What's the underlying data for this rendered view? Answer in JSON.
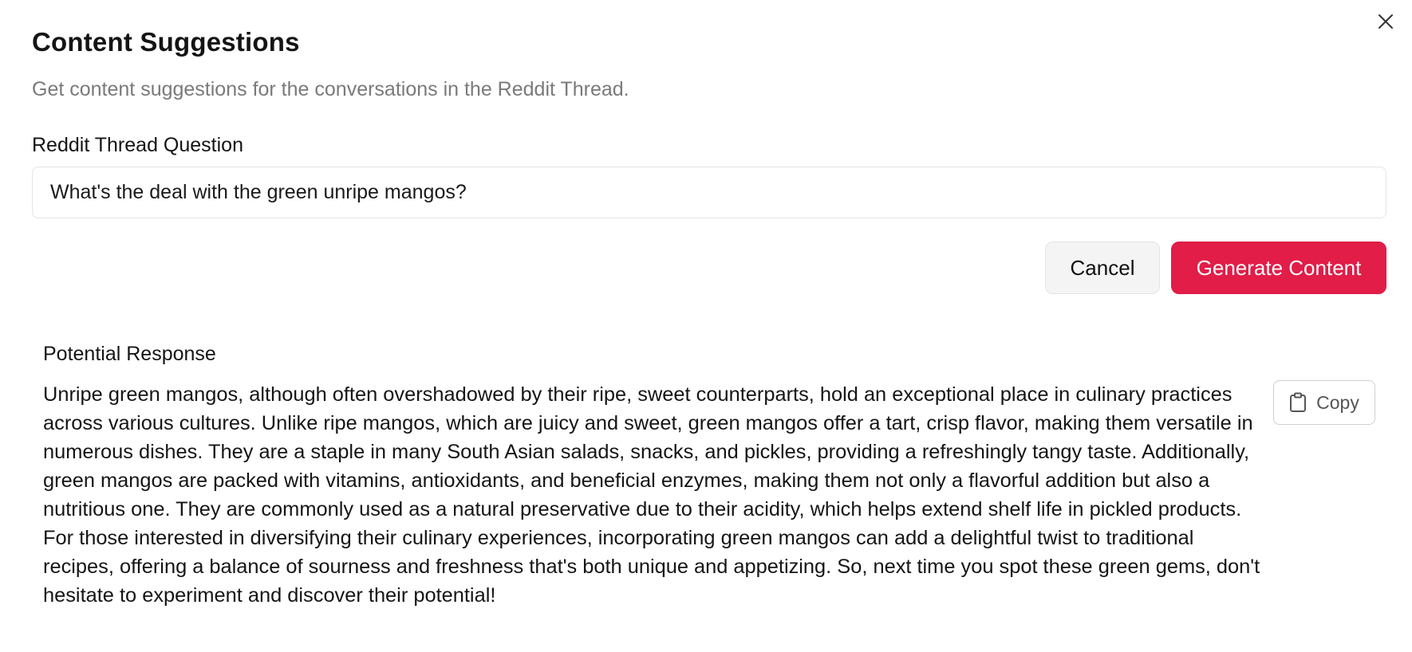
{
  "dialog": {
    "title": "Content Suggestions",
    "subtitle": "Get content suggestions for the conversations in the Reddit Thread.",
    "close_icon": "close-icon"
  },
  "form": {
    "question_label": "Reddit Thread Question",
    "question_value": "What's the deal with the green unripe mangos?"
  },
  "actions": {
    "cancel_label": "Cancel",
    "generate_label": "Generate Content"
  },
  "response": {
    "label": "Potential Response",
    "text": "Unripe green mangos, although often overshadowed by their ripe, sweet counterparts, hold an exceptional place in culinary practices across various cultures. Unlike ripe mangos, which are juicy and sweet, green mangos offer a tart, crisp flavor, making them versatile in numerous dishes. They are a staple in many South Asian salads, snacks, and pickles, providing a refreshingly tangy taste. Additionally, green mangos are packed with vitamins, antioxidants, and beneficial enzymes, making them not only a flavorful addition but also a nutritious one. They are commonly used as a natural preservative due to their acidity, which helps extend shelf life in pickled products. For those interested in diversifying their culinary experiences, incorporating green mangos can add a delightful twist to traditional recipes, offering a balance of sourness and freshness that's both unique and appetizing. So, next time you spot these green gems, don't hesitate to experiment and discover their potential!",
    "copy_label": "Copy",
    "copy_icon": "clipboard-icon"
  },
  "colors": {
    "accent": "#e11d48",
    "muted_text": "#7a7a7a",
    "border": "#e4e4e7"
  }
}
